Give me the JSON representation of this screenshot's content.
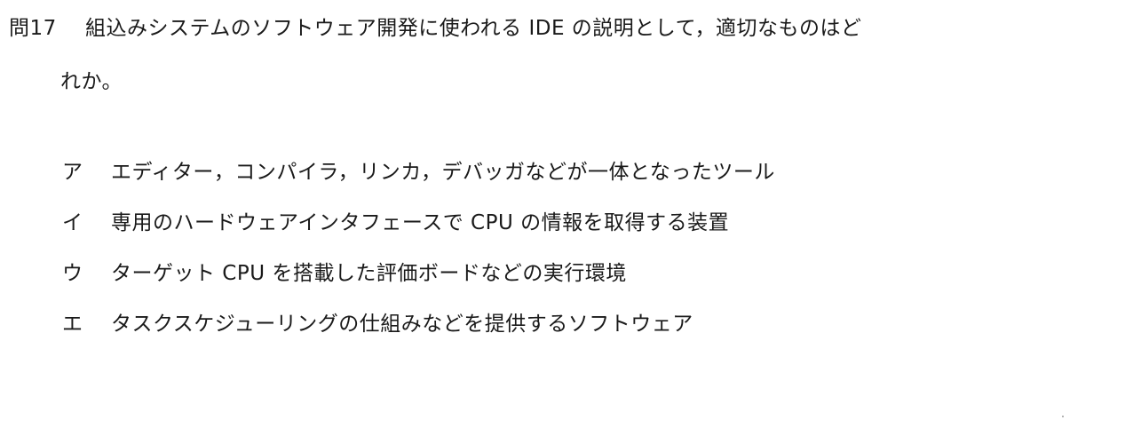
{
  "question": {
    "number": "問17",
    "text_line1": "組込みシステムのソフトウェア開発に使われる IDE の説明として，適切なものはど",
    "text_line2": "れか。"
  },
  "choices": [
    {
      "label": "ア",
      "text": "エディター，コンパイラ，リンカ，デバッガなどが一体となったツール"
    },
    {
      "label": "イ",
      "text": "専用のハードウェアインタフェースで CPU の情報を取得する装置"
    },
    {
      "label": "ウ",
      "text": "ターゲット CPU を搭載した評価ボードなどの実行環境"
    },
    {
      "label": "エ",
      "text": "タスクスケジューリングの仕組みなどを提供するソフトウェア"
    }
  ]
}
